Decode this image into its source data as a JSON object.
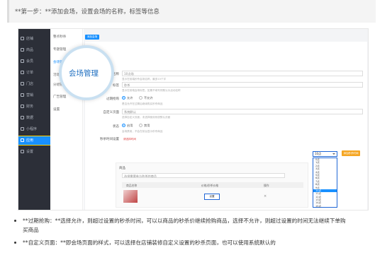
{
  "step_note": "**第一步：**添加会场，设置会场的名称，标签等信息",
  "sidebar": {
    "items": [
      {
        "label": "店铺"
      },
      {
        "label": "商品"
      },
      {
        "label": "会员"
      },
      {
        "label": "订单"
      },
      {
        "label": "门店"
      },
      {
        "label": "营销"
      },
      {
        "label": "财务"
      },
      {
        "label": "数据"
      },
      {
        "label": "小程序"
      },
      {
        "label": "应用"
      },
      {
        "label": "设置"
      }
    ],
    "active_index": 9
  },
  "subnav": {
    "items": [
      {
        "label": "整点秒杀"
      },
      {
        "label": "专题管理"
      },
      {
        "label": "会场管理"
      },
      {
        "label": "活动数据"
      },
      {
        "label": "分组管理"
      },
      {
        "label": "广告管理"
      },
      {
        "label": "设置"
      }
    ]
  },
  "magnifier_label": "会场管理",
  "tab_button": "添加会场",
  "form": {
    "name_label": "会场名称",
    "name_value": "10点场",
    "name_hint": "显示在前端秒杀会场名称，最多10个字",
    "tag_label": "标签",
    "tag_value": "秒杀",
    "tag_hint": "显示在前端会场标签，如果不填写则默认为活动名称",
    "overdue_label": "过期抢购",
    "overdue_yes": "允许",
    "overdue_no": "不允许",
    "overdue_hint": "是否允许在过期后继续购买秒杀商品",
    "custom_label": "自定义页面",
    "custom_value": "系统默认",
    "custom_hint": "选择自定义页面，未选择使用系统默认页面",
    "status_label": "状态",
    "status_on": "启用",
    "status_off": "禁用",
    "status_hint": "会场禁用，不会在前台显示秒杀商品",
    "time_label": "秒杀时间设置",
    "time_value": "请选择时间",
    "set_button": "添加秒杀时间",
    "goods_label": "商品",
    "goods_placeholder": "选择需要参与秒杀的商品"
  },
  "time_list": [
    "0点",
    "1点",
    "2点",
    "3点",
    "4点",
    "5点",
    "6点",
    "7点",
    "8点",
    "9点",
    "10点",
    "11点",
    "12点",
    "13点",
    "14点",
    "15点"
  ],
  "time_selected_index": 10,
  "product_table": {
    "headers": [
      "商品名称",
      "价格/秒杀价格",
      "操作"
    ],
    "price_button": "设置"
  },
  "bullets": [
    {
      "text": "**过期抢购：**选择允许，则超过设置的秒杀时间，可以以商品的秒杀价继续抢购商品，选择不允许，则超过设置的时间无法继续下单购",
      "cont": "买商品"
    },
    {
      "text": "**自定义页面：**即会场页面的样式，可以选择在店铺装修自定义设置的秒杀页面，也可以使用系统默认的",
      "cont": ""
    }
  ]
}
